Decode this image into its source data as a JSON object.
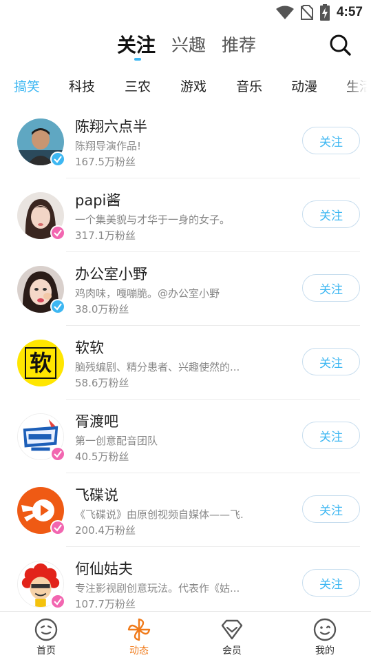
{
  "status_bar": {
    "time": "4:57"
  },
  "top_tabs": [
    {
      "label": "关注",
      "active": true
    },
    {
      "label": "兴趣",
      "active": false
    },
    {
      "label": "推荐",
      "active": false
    }
  ],
  "categories": [
    {
      "label": "搞笑",
      "active": true
    },
    {
      "label": "科技"
    },
    {
      "label": "三农"
    },
    {
      "label": "游戏"
    },
    {
      "label": "音乐"
    },
    {
      "label": "动漫"
    },
    {
      "label": "生活"
    }
  ],
  "follow_label": "关注",
  "channels": [
    {
      "name": "陈翔六点半",
      "desc": "陈翔导演作品!",
      "fans": "167.5万粉丝",
      "verify_color": "#3db7f2"
    },
    {
      "name": "papi酱",
      "desc": "一个集美貌与才华于一身的女子。",
      "fans": "317.1万粉丝",
      "verify_color": "#f266b0"
    },
    {
      "name": "办公室小野",
      "desc": "鸡肉味，嘎嘣脆。@办公室小野",
      "fans": "38.0万粉丝",
      "verify_color": "#3db7f2"
    },
    {
      "name": "软软",
      "desc": "脑残编剧、精分患者、兴趣使然的...",
      "fans": "58.6万粉丝",
      "avatar_text": "软"
    },
    {
      "name": "胥渡吧",
      "desc": "第一创意配音团队",
      "fans": "40.5万粉丝",
      "verify_color": "#f266b0"
    },
    {
      "name": "飞碟说",
      "desc": "《飞碟说》由原创视频自媒体——飞.",
      "fans": "200.4万粉丝",
      "verify_color": "#f266b0"
    },
    {
      "name": "何仙姑夫",
      "desc": "专注影视剧创意玩法。代表作《姑...",
      "fans": "107.7万粉丝",
      "verify_color": "#f266b0"
    }
  ],
  "bottom_nav": [
    {
      "label": "首页",
      "icon": "smiley-home-icon",
      "active": false
    },
    {
      "label": "动态",
      "icon": "pinwheel-icon",
      "active": true
    },
    {
      "label": "会员",
      "icon": "diamond-icon",
      "active": false
    },
    {
      "label": "我的",
      "icon": "smiley-wink-icon",
      "active": false
    }
  ],
  "colors": {
    "accent": "#3db7f2",
    "nav_active": "#f07a1a"
  }
}
